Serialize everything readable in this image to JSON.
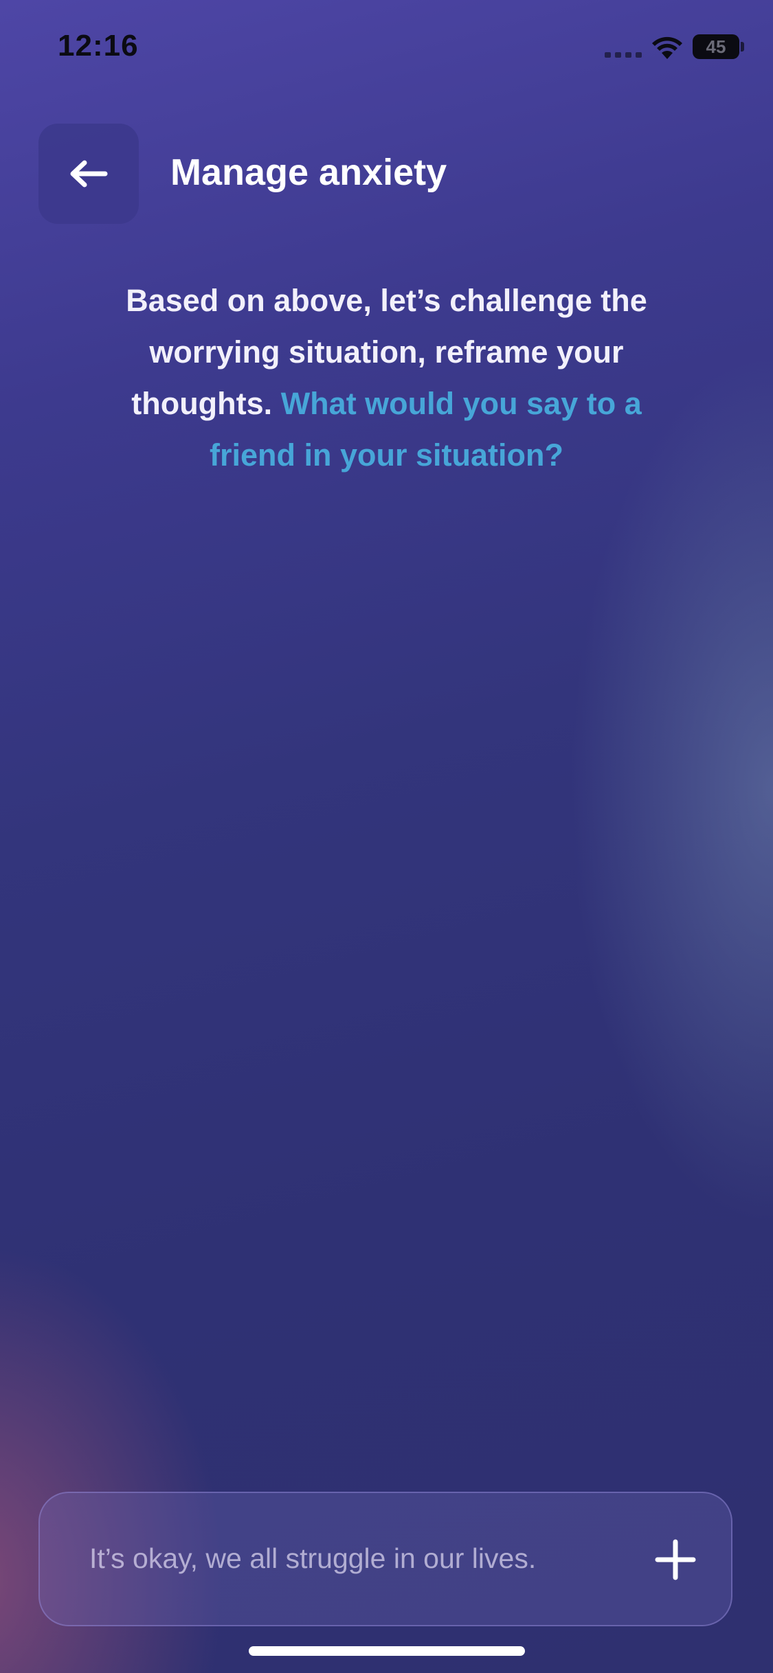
{
  "status_bar": {
    "time": "12:16",
    "battery": "45"
  },
  "header": {
    "title": "Manage anxiety",
    "back_icon": "arrow-left-icon"
  },
  "prompt": {
    "text": "Based on above, let’s challenge the worrying situation, reframe your thoughts.",
    "highlight": "What would you say to a friend in your situation?"
  },
  "input": {
    "placeholder": "It’s okay, we all struggle in our lives.",
    "add_icon": "plus-icon"
  },
  "colors": {
    "accent": "#47a6d8",
    "text": "#ffffff"
  }
}
